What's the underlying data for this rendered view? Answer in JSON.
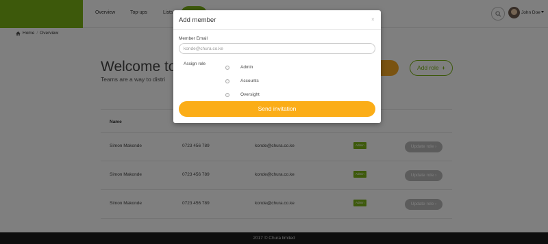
{
  "nav": {
    "items": [
      "Overview",
      "Top-ups",
      "Lists"
    ],
    "user_name": "John Doe"
  },
  "breadcrumb": {
    "home": "Home",
    "current": "Overview"
  },
  "page": {
    "welcome": "Welcome to",
    "subtitle": "Teams are a way to distri",
    "add_member_label": "er",
    "add_role_label": "Add role",
    "plus": "+"
  },
  "table": {
    "header_name": "Name",
    "rows": [
      {
        "name": "Simon Makonde",
        "phone": "0723 456 789",
        "email": "konde@chura.co.ke",
        "badge": "Admin",
        "action": "Update role ›"
      },
      {
        "name": "Simon Makonde",
        "phone": "0723 456 789",
        "email": "konde@chura.co.ke",
        "badge": "Admin",
        "action": "Update role ›"
      },
      {
        "name": "Simon Makonde",
        "phone": "0723 456 789",
        "email": "konde@chura.co.ke",
        "badge": "Admin",
        "action": "Update role ›"
      }
    ]
  },
  "footer": {
    "text": "2017 © Chura limited"
  },
  "modal": {
    "title": "Add member",
    "close": "×",
    "email_label": "Member Email",
    "email_placeholder": "konde@chura.co.ke",
    "assign_label": "Assign role",
    "roles": [
      "Admin",
      "Accounts",
      "Oversight"
    ],
    "submit_label": "Send invitation"
  },
  "colors": {
    "brand_green": "#7ab317",
    "accent_orange": "#fbad17",
    "backdrop": "rgba(0,0,0,0.5)"
  }
}
